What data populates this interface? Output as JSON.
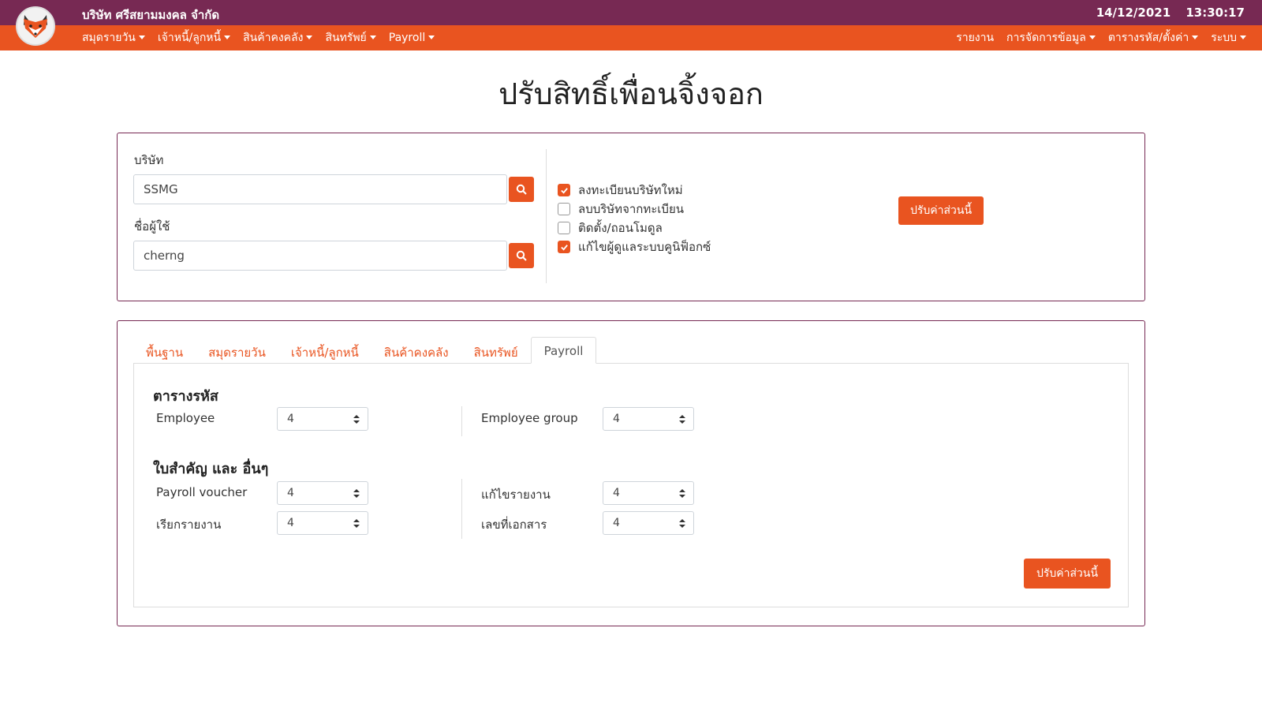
{
  "header": {
    "company_name": "บริษัท ศรีสยามมงคล จำกัด",
    "date": "14/12/2021",
    "time": "13:30:17"
  },
  "nav": {
    "left_items": [
      {
        "label": "สมุดรายวัน"
      },
      {
        "label": "เจ้าหนี้/ลูกหนี้"
      },
      {
        "label": "สินค้าคงคลัง"
      },
      {
        "label": "สินทรัพย์"
      },
      {
        "label": "Payroll"
      }
    ],
    "right_items": [
      {
        "label": "รายงาน"
      },
      {
        "label": "การจัดการข้อมูล"
      },
      {
        "label": "ตารางรหัส/ตั้งค่า"
      },
      {
        "label": "ระบบ"
      }
    ]
  },
  "page": {
    "title": "ปรับสิทธิ์เพื่อนจิ้งจอก"
  },
  "form": {
    "company_label": "บริษัท",
    "company_value": "SSMG",
    "user_label": "ชื่อผู้ใช้",
    "user_value": "cherng",
    "checkboxes": [
      {
        "label": "ลงทะเบียนบริษัทใหม่",
        "checked": true
      },
      {
        "label": "ลบบริษัทจากทะเบียน",
        "checked": false
      },
      {
        "label": "ติดตั้ง/ถอนโมดูล",
        "checked": false
      },
      {
        "label": "แก้ไขผู้ดูแลระบบคูนิฟ็อกซ์",
        "checked": true
      }
    ],
    "apply_label": "ปรับค่าส่วนนี้"
  },
  "tabs": {
    "items": [
      {
        "label": "พื้นฐาน",
        "active": false
      },
      {
        "label": "สมุดรายวัน",
        "active": false
      },
      {
        "label": "เจ้าหนี้/ลูกหนี้",
        "active": false
      },
      {
        "label": "สินค้าคงคลัง",
        "active": false
      },
      {
        "label": "สินทรัพย์",
        "active": false
      },
      {
        "label": "Payroll",
        "active": true
      }
    ]
  },
  "payroll": {
    "section1_title": "ตารางรหัส",
    "section1_rows": [
      {
        "label": "Employee",
        "value": "4"
      },
      {
        "label": "Employee group",
        "value": "4"
      }
    ],
    "section2_title": "ใบสำคัญ และ อื่นๆ",
    "section2_rows": [
      {
        "label": "Payroll voucher",
        "value": "4"
      },
      {
        "label": "แก้ไขรายงาน",
        "value": "4"
      },
      {
        "label": "เรียกรายงาน",
        "value": "4"
      },
      {
        "label": "เลขที่เอกสาร",
        "value": "4"
      }
    ],
    "apply_label": "ปรับค่าส่วนนี้"
  },
  "colors": {
    "topbar": "#772953",
    "navbar": "#e95420",
    "accent": "#e95420"
  }
}
